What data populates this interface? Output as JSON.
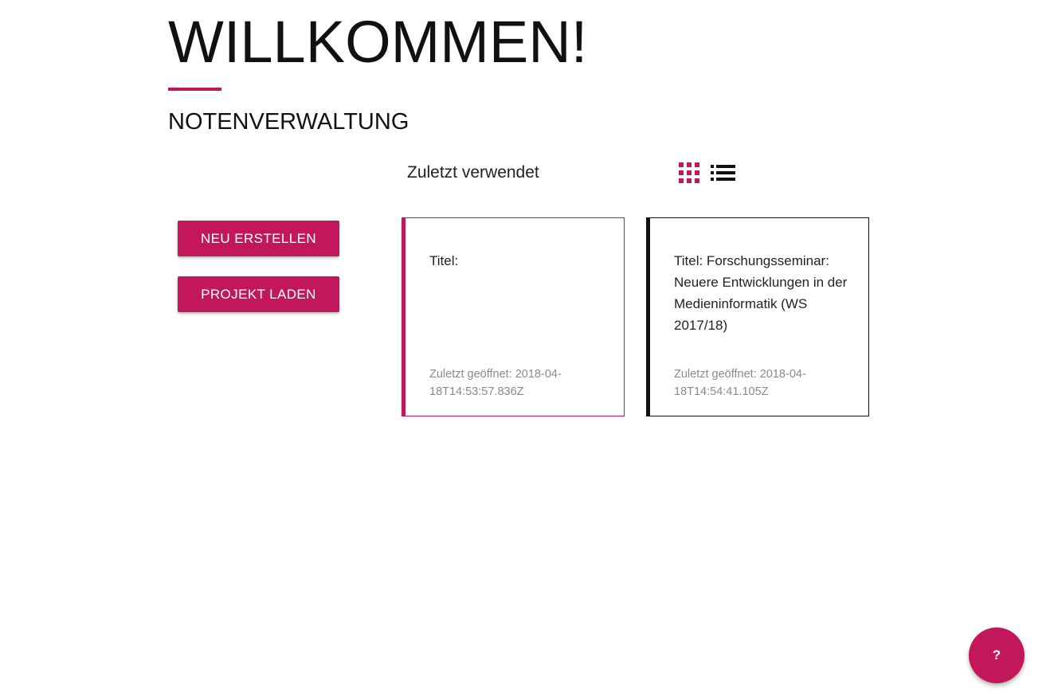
{
  "header": {
    "title": "WILLKOMMEN!",
    "subtitle": "NOTENVERWALTUNG"
  },
  "recent": {
    "label": "Zuletzt verwendet",
    "view_modes": [
      {
        "name": "grid-view-icon",
        "active": true
      },
      {
        "name": "list-view-icon",
        "active": false
      }
    ]
  },
  "actions": {
    "new_label": "NEU ERSTELLEN",
    "load_label": "PROJEKT LADEN"
  },
  "projects": [
    {
      "title": "Titel:",
      "opened": "Zuletzt geöffnet: 2018-04-18T14:53:57.836Z",
      "selected": true
    },
    {
      "title": "Titel: Forschungsseminar: Neuere Entwicklungen in der Medieninformatik (WS 2017/18)",
      "opened": "Zuletzt geöffnet: 2018-04-18T14:54:41.105Z",
      "selected": false
    }
  ],
  "help": {
    "label": "?"
  },
  "colors": {
    "accent": "#c2185b",
    "text": "#111111",
    "muted": "#8a8a8a"
  }
}
